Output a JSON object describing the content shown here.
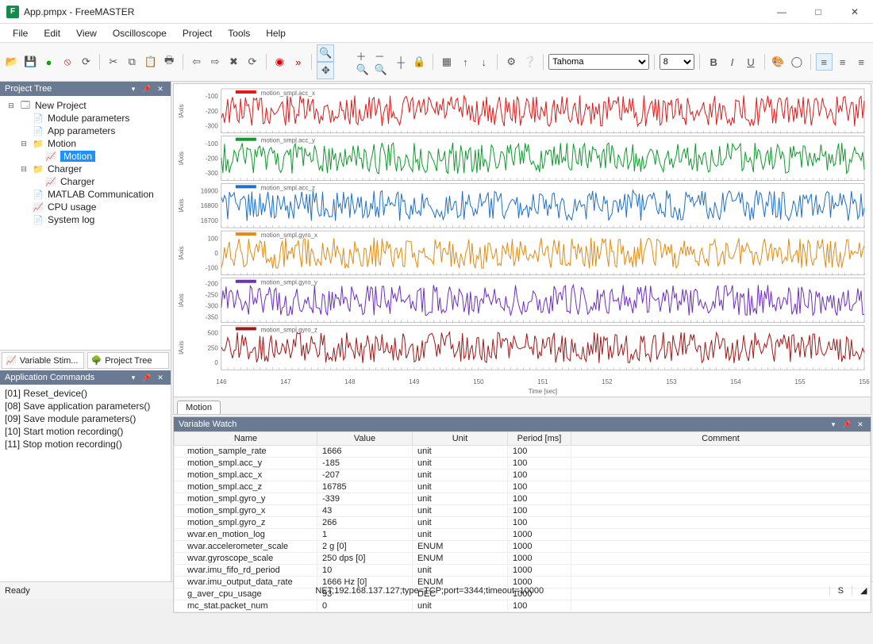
{
  "app": {
    "title": "App.pmpx - FreeMASTER",
    "icon_letter": "F"
  },
  "menu": [
    "File",
    "Edit",
    "View",
    "Oscilloscope",
    "Project",
    "Tools",
    "Help"
  ],
  "toolbar": {
    "font_name": "Tahoma",
    "font_size": "8"
  },
  "panes": {
    "project_tree": "Project Tree",
    "app_commands": "Application Commands",
    "var_watch": "Variable Watch"
  },
  "project_tree": {
    "root": {
      "label": "New Project"
    },
    "items": [
      {
        "label": "Module parameters",
        "indent": 1,
        "icon": "page-icon"
      },
      {
        "label": "App parameters",
        "indent": 1,
        "icon": "page-icon"
      },
      {
        "label": "Motion",
        "indent": 1,
        "icon": "folder-icon",
        "exp": "-"
      },
      {
        "label": "Motion",
        "indent": 2,
        "icon": "scope-icon",
        "selected": true
      },
      {
        "label": "Charger",
        "indent": 1,
        "icon": "folder-icon",
        "exp": "-"
      },
      {
        "label": "Charger",
        "indent": 2,
        "icon": "scope-icon"
      },
      {
        "label": "MATLAB Communication",
        "indent": 1,
        "icon": "page-icon"
      },
      {
        "label": "CPU usage",
        "indent": 1,
        "icon": "scope-icon"
      },
      {
        "label": "System log",
        "indent": 1,
        "icon": "page-icon"
      }
    ]
  },
  "project_tabs": {
    "stim": "Variable Stim...",
    "tree": "Project Tree"
  },
  "app_commands": [
    "[01] Reset_device()",
    "[08] Save application parameters()",
    "[09] Save module parameters()",
    "[10] Start motion recording()",
    "[11] Stop motion recording()"
  ],
  "scope": {
    "tab_label": "Motion",
    "x_label": "Time [sec]",
    "y_label": "lAxis",
    "x_ticks": [
      "146",
      "147",
      "148",
      "149",
      "150",
      "151",
      "152",
      "153",
      "154",
      "155",
      "156"
    ],
    "series": [
      {
        "name": "motion_smpl.acc_x",
        "color": "#e11919",
        "ticks": [
          "-100",
          "-200",
          "-300"
        ]
      },
      {
        "name": "motion_smpl.acc_y",
        "color": "#109a2d",
        "ticks": [
          "-100",
          "-200",
          "-300"
        ]
      },
      {
        "name": "motion_smpl.acc_z",
        "color": "#1f70c9",
        "ticks": [
          "16900",
          "16800",
          "16700"
        ]
      },
      {
        "name": "motion_smpl.gyro_x",
        "color": "#e38b14",
        "ticks": [
          "100",
          "0",
          "-100"
        ]
      },
      {
        "name": "motion_smpl.gyro_y",
        "color": "#6b2fc2",
        "ticks": [
          "-200",
          "-250",
          "-300",
          "-350"
        ]
      },
      {
        "name": "motion_smpl.gyro_z",
        "color": "#a21717",
        "ticks": [
          "500",
          "250",
          "0"
        ]
      }
    ]
  },
  "chart_data": [
    {
      "type": "line",
      "title": "motion_smpl.acc_x",
      "x_range": [
        145,
        156
      ],
      "xlabel": "Time [sec]",
      "ylabel": "lAxis",
      "ylim": [
        -350,
        -50
      ],
      "series": [
        {
          "name": "motion_smpl.acc_x",
          "mean": -207,
          "noise_amplitude": 80
        }
      ]
    },
    {
      "type": "line",
      "title": "motion_smpl.acc_y",
      "x_range": [
        145,
        156
      ],
      "xlabel": "Time [sec]",
      "ylabel": "lAxis",
      "ylim": [
        -350,
        -50
      ],
      "series": [
        {
          "name": "motion_smpl.acc_y",
          "mean": -185,
          "noise_amplitude": 80
        }
      ]
    },
    {
      "type": "line",
      "title": "motion_smpl.acc_z",
      "x_range": [
        145,
        156
      ],
      "xlabel": "Time [sec]",
      "ylabel": "lAxis",
      "ylim": [
        16650,
        16950
      ],
      "series": [
        {
          "name": "motion_smpl.acc_z",
          "mean": 16785,
          "noise_amplitude": 90
        }
      ]
    },
    {
      "type": "line",
      "title": "motion_smpl.gyro_x",
      "x_range": [
        145,
        156
      ],
      "xlabel": "Time [sec]",
      "ylabel": "lAxis",
      "ylim": [
        -150,
        150
      ],
      "series": [
        {
          "name": "motion_smpl.gyro_x",
          "mean": 43,
          "noise_amplitude": 90
        }
      ]
    },
    {
      "type": "line",
      "title": "motion_smpl.gyro_y",
      "x_range": [
        145,
        156
      ],
      "xlabel": "Time [sec]",
      "ylabel": "lAxis",
      "ylim": [
        -400,
        -180
      ],
      "series": [
        {
          "name": "motion_smpl.gyro_y",
          "mean": -300,
          "noise_amplitude": 60
        }
      ]
    },
    {
      "type": "line",
      "title": "motion_smpl.gyro_z",
      "x_range": [
        145,
        156
      ],
      "xlabel": "Time [sec]",
      "ylabel": "lAxis",
      "ylim": [
        -100,
        550
      ],
      "series": [
        {
          "name": "motion_smpl.gyro_z",
          "mean": 266,
          "noise_amplitude": 130
        }
      ]
    }
  ],
  "var_watch": {
    "columns": [
      "Name",
      "Value",
      "Unit",
      "Period [ms]",
      "Comment"
    ],
    "rows": [
      {
        "name": "motion_sample_rate",
        "value": "1666",
        "unit": "unit",
        "period": "100",
        "comment": ""
      },
      {
        "name": "motion_smpl.acc_y",
        "value": "-185",
        "unit": "unit",
        "period": "100",
        "comment": ""
      },
      {
        "name": "motion_smpl.acc_x",
        "value": "-207",
        "unit": "unit",
        "period": "100",
        "comment": ""
      },
      {
        "name": "motion_smpl.acc_z",
        "value": "16785",
        "unit": "unit",
        "period": "100",
        "comment": ""
      },
      {
        "name": "motion_smpl.gyro_y",
        "value": "-339",
        "unit": "unit",
        "period": "100",
        "comment": ""
      },
      {
        "name": "motion_smpl.gyro_x",
        "value": "43",
        "unit": "unit",
        "period": "100",
        "comment": ""
      },
      {
        "name": "motion_smpl.gyro_z",
        "value": "266",
        "unit": "unit",
        "period": "100",
        "comment": ""
      },
      {
        "name": "wvar.en_motion_log",
        "value": "1",
        "unit": "unit",
        "period": "1000",
        "comment": ""
      },
      {
        "name": "wvar.accelerometer_scale",
        "value": "2 g [0]",
        "unit": "ENUM",
        "period": "1000",
        "comment": ""
      },
      {
        "name": "wvar.gyroscope_scale",
        "value": "250 dps [0]",
        "unit": "ENUM",
        "period": "1000",
        "comment": ""
      },
      {
        "name": "wvar.imu_fifo_rd_period",
        "value": "10",
        "unit": "unit",
        "period": "1000",
        "comment": ""
      },
      {
        "name": "wvar.imu_output_data_rate",
        "value": "1666 Hz [0]",
        "unit": "ENUM",
        "period": "1000",
        "comment": ""
      },
      {
        "name": "g_aver_cpu_usage",
        "value": "93",
        "unit": "DEC",
        "period": "1000",
        "comment": ""
      },
      {
        "name": "mc_stat.packet_num",
        "value": "0",
        "unit": "unit",
        "period": "100",
        "comment": ""
      }
    ]
  },
  "status": {
    "left": "Ready",
    "center": "NET;192.168.137.127;type=TCP;port=3344;timeout=10000",
    "right": "S"
  }
}
